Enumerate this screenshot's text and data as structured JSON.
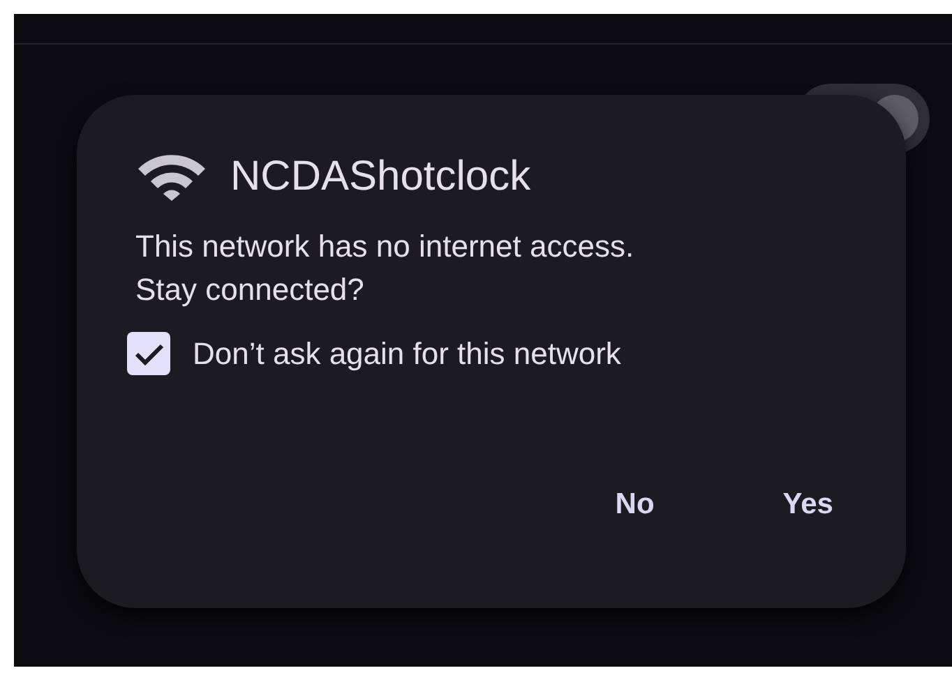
{
  "background": {
    "toggle": {
      "on": true
    }
  },
  "dialog": {
    "title": "NCDAShotclock",
    "message": "This network has no internet access.\nStay connected?",
    "checkbox": {
      "label": "Don’t ask again for this network",
      "checked": true
    },
    "buttons": [
      {
        "label": "No"
      },
      {
        "label": "Yes"
      }
    ]
  }
}
